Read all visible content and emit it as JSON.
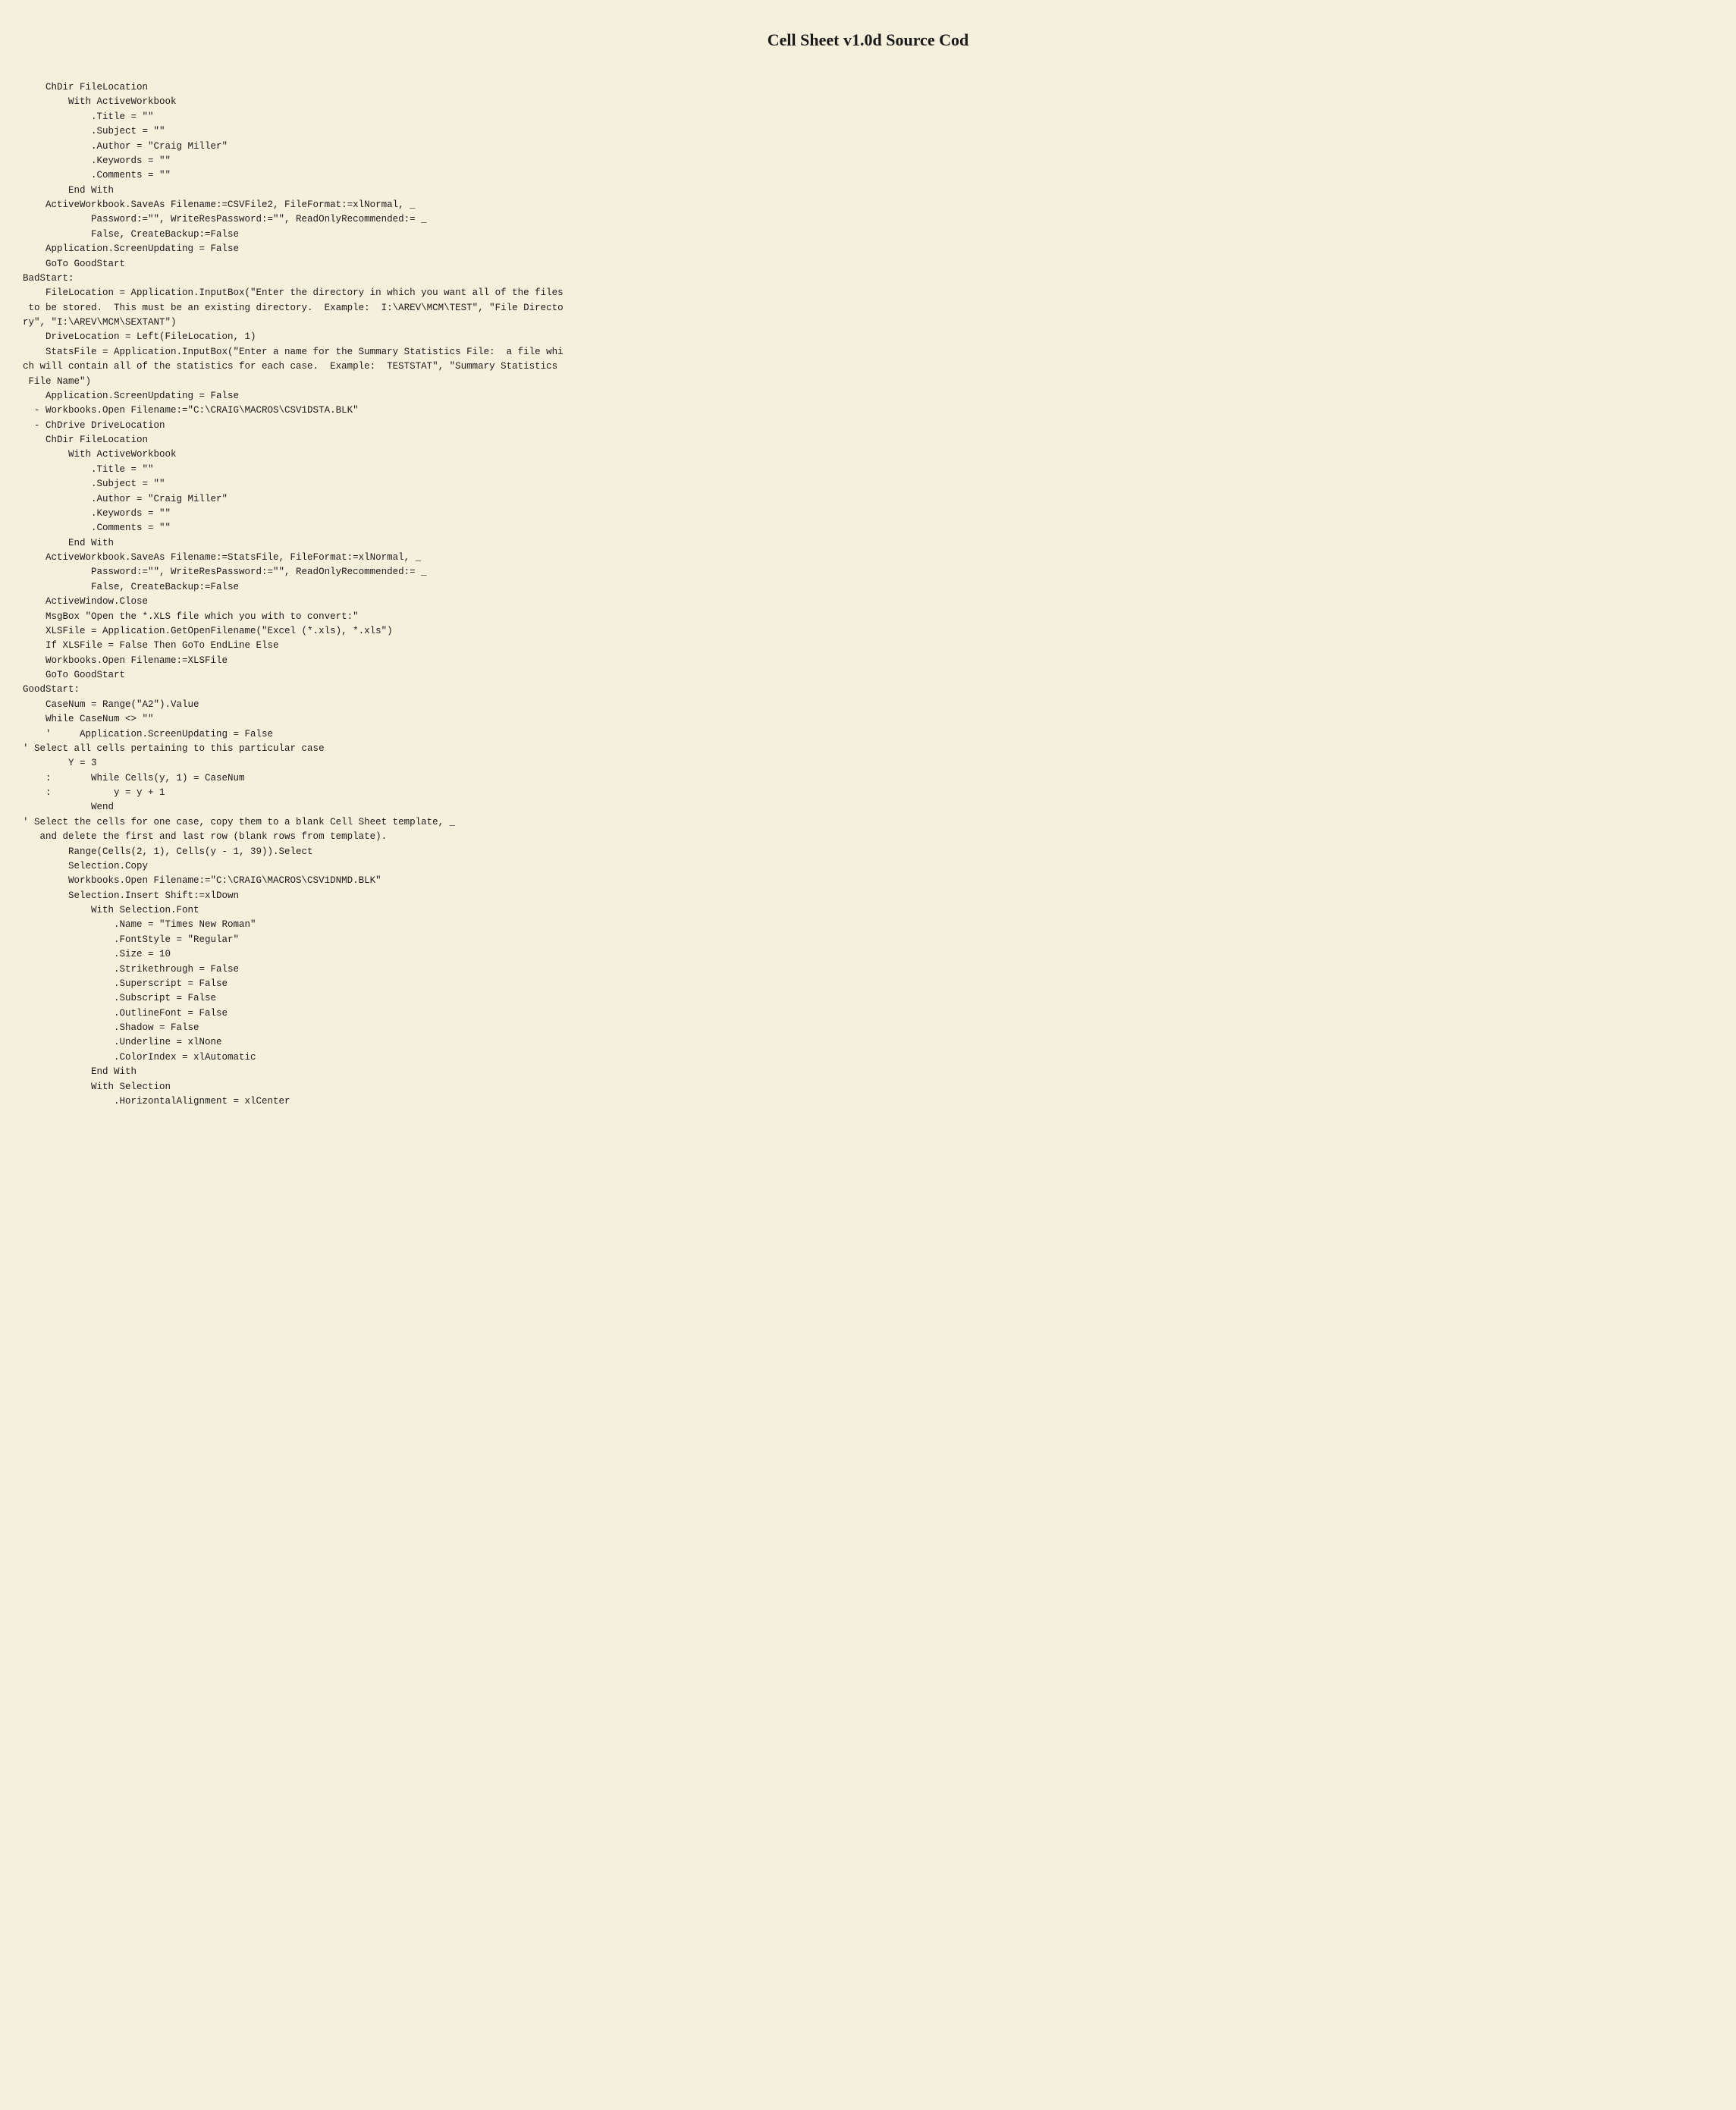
{
  "page": {
    "title": "Cell Sheet v1.0d Source Cod",
    "code": "    ChDir FileLocation\n        With ActiveWorkbook\n            .Title = \"\"\n            .Subject = \"\"\n            .Author = \"Craig Miller\"\n            .Keywords = \"\"\n            .Comments = \"\"\n        End With\n    ActiveWorkbook.SaveAs Filename:=CSVFile2, FileFormat:=xlNormal, _\n            Password:=\"\", WriteResPassword:=\"\", ReadOnlyRecommended:= _\n            False, CreateBackup:=False\n    Application.ScreenUpdating = False\n    GoTo GoodStart\nBadStart:\n    FileLocation = Application.InputBox(\"Enter the directory in which you want all of the files\n to be stored.  This must be an existing directory.  Example:  I:\\AREV\\MCM\\TEST\", \"File Directo\nry\", \"I:\\AREV\\MCM\\SEXTANT\")\n    DriveLocation = Left(FileLocation, 1)\n    StatsFile = Application.InputBox(\"Enter a name for the Summary Statistics File:  a file whi\nch will contain all of the statistics for each case.  Example:  TESTSTAT\", \"Summary Statistics\n File Name\")\n    Application.ScreenUpdating = False\n  - Workbooks.Open Filename:=\"C:\\CRAIG\\MACROS\\CSV1DSTA.BLK\"\n  - ChDrive DriveLocation\n    ChDir FileLocation\n        With ActiveWorkbook\n            .Title = \"\"\n            .Subject = \"\"\n            .Author = \"Craig Miller\"\n            .Keywords = \"\"\n            .Comments = \"\"\n        End With\n    ActiveWorkbook.SaveAs Filename:=StatsFile, FileFormat:=xlNormal, _\n            Password:=\"\", WriteResPassword:=\"\", ReadOnlyRecommended:= _\n            False, CreateBackup:=False\n    ActiveWindow.Close\n    MsgBox \"Open the *.XLS file which you with to convert:\"\n    XLSFile = Application.GetOpenFilename(\"Excel (*.xls), *.xls\")\n    If XLSFile = False Then GoTo EndLine Else\n    Workbooks.Open Filename:=XLSFile\n    GoTo GoodStart\nGoodStart:\n    CaseNum = Range(\"A2\").Value\n    While CaseNum <> \"\"\n    '     Application.ScreenUpdating = False\n' Select all cells pertaining to this particular case\n        Y = 3\n    :       While Cells(y, 1) = CaseNum\n    :           y = y + 1\n            Wend\n' Select the cells for one case, copy them to a blank Cell Sheet template, _\n   and delete the first and last row (blank rows from template).\n        Range(Cells(2, 1), Cells(y - 1, 39)).Select\n        Selection.Copy\n        Workbooks.Open Filename:=\"C:\\CRAIG\\MACROS\\CSV1DNMD.BLK\"\n        Selection.Insert Shift:=xlDown\n            With Selection.Font\n                .Name = \"Times New Roman\"\n                .FontStyle = \"Regular\"\n                .Size = 10\n                .Strikethrough = False\n                .Superscript = False\n                .Subscript = False\n                .OutlineFont = False\n                .Shadow = False\n                .Underline = xlNone\n                .ColorIndex = xlAutomatic\n            End With\n            With Selection\n                .HorizontalAlignment = xlCenter"
  }
}
